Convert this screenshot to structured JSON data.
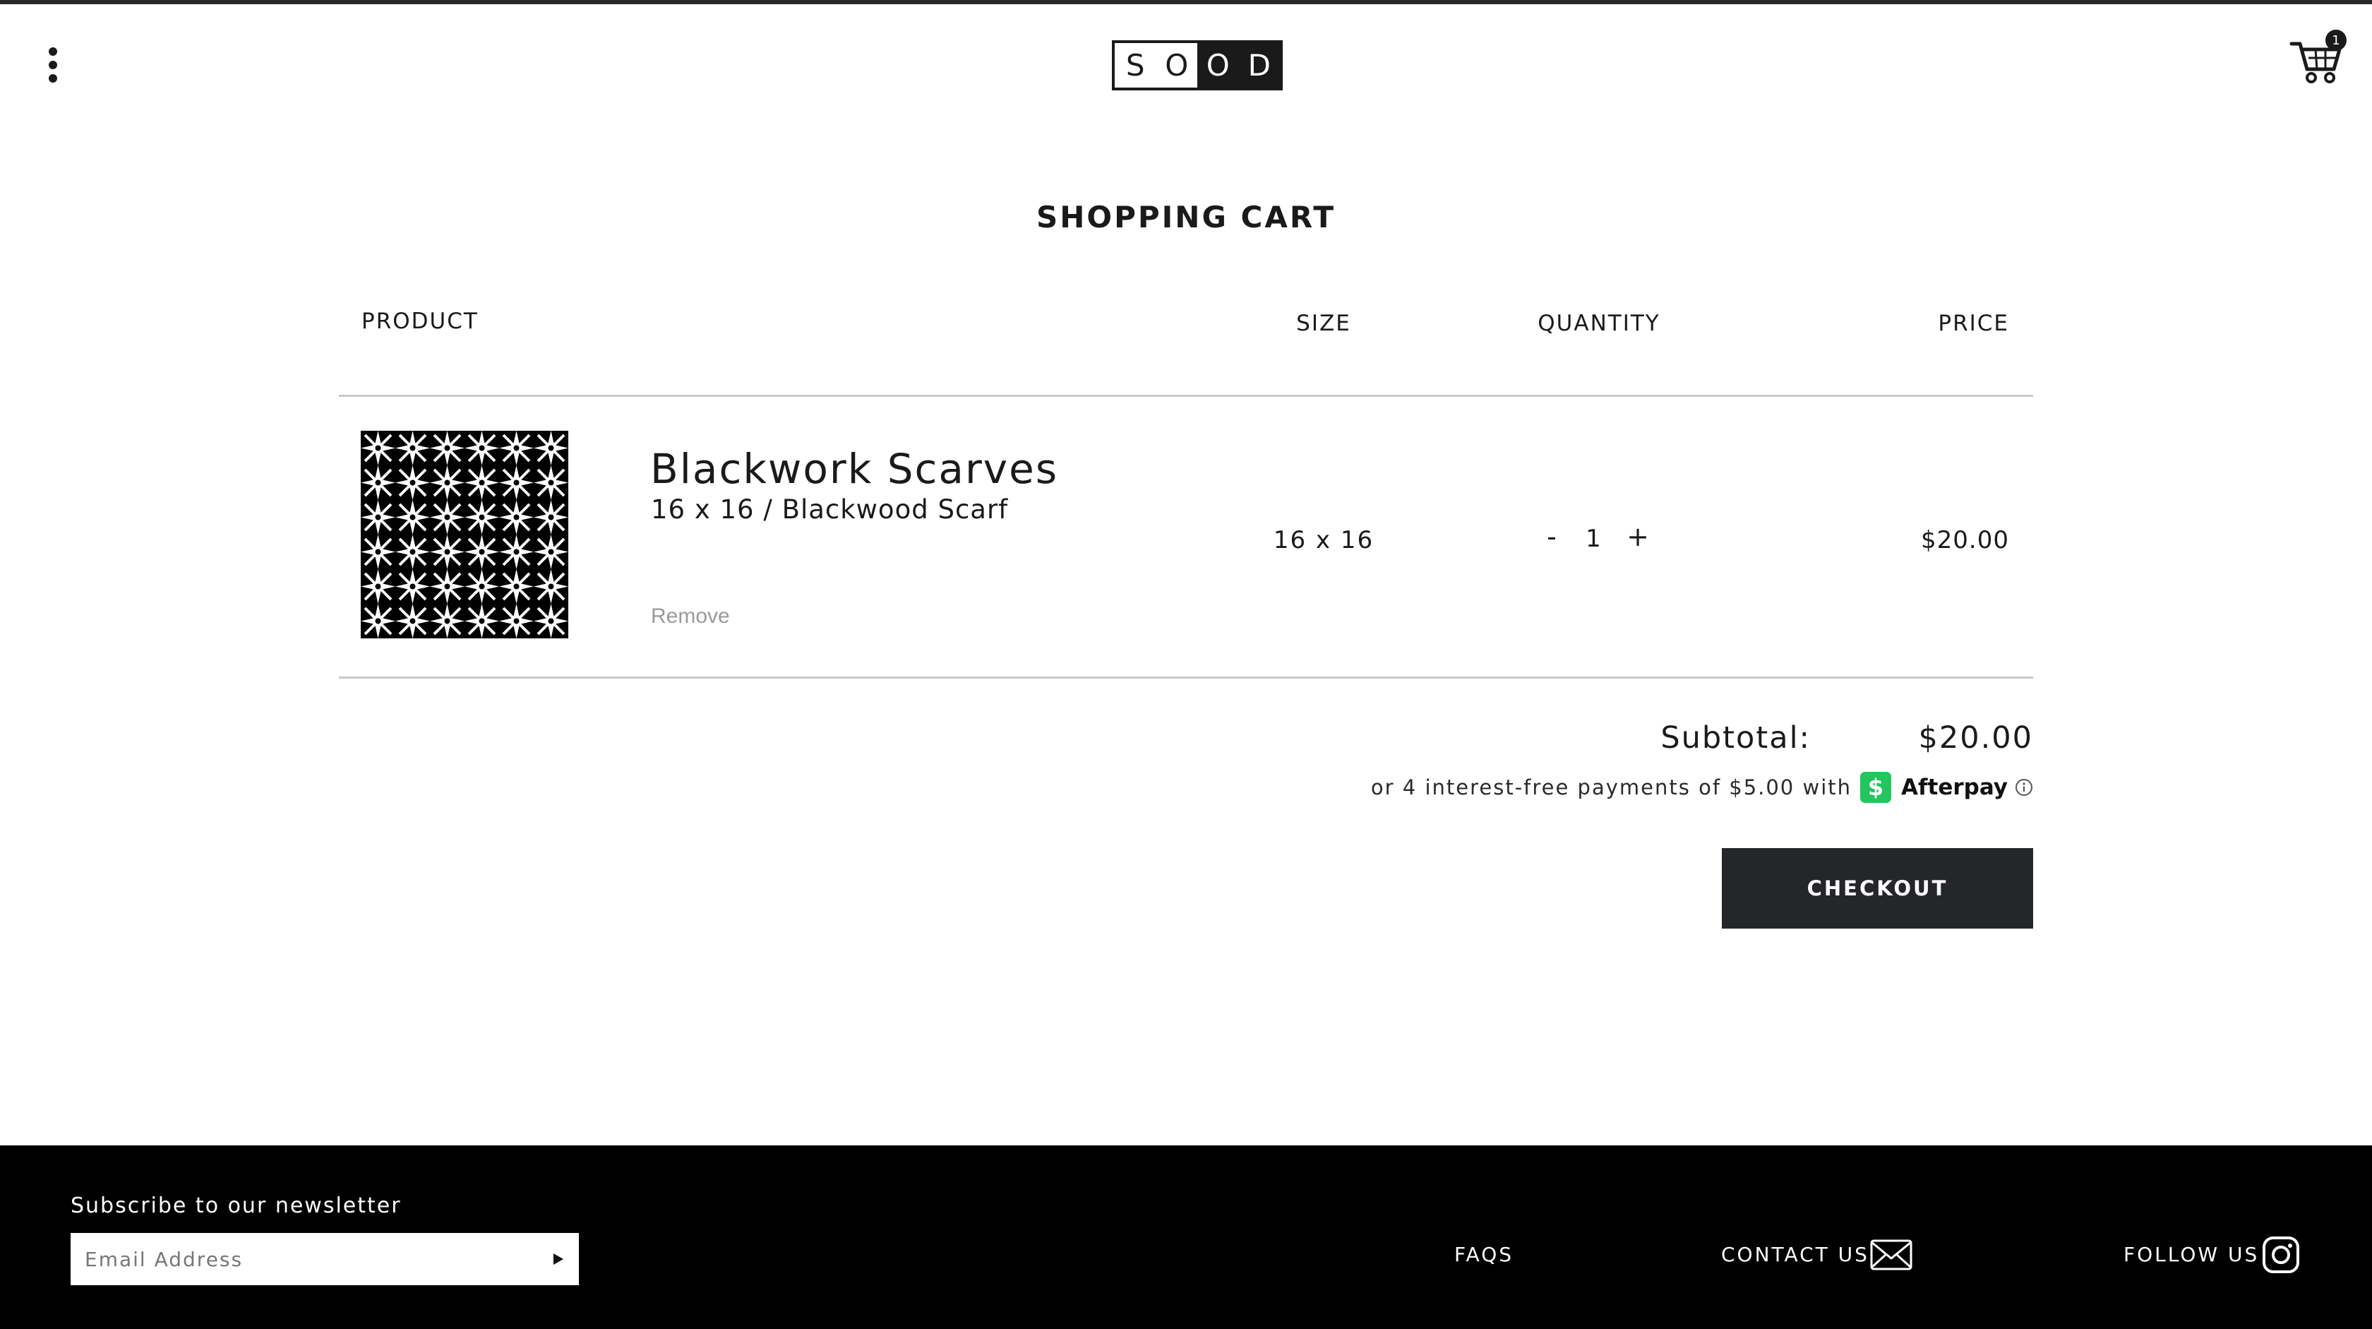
{
  "header": {
    "logo_letters": [
      "S",
      "O",
      "O",
      "D"
    ],
    "cart_count": "1",
    "icons": {
      "menu": "vertical-dots-icon",
      "cart": "cart-icon"
    }
  },
  "page": {
    "title": "SHOPPING CART"
  },
  "table": {
    "headers": {
      "product": "PRODUCT",
      "size": "SIZE",
      "quantity": "QUANTITY",
      "price": "PRICE"
    },
    "items": [
      {
        "name": "Blackwork Scarves",
        "variant": "16 x 16 / Blackwood Scarf",
        "remove_label": "Remove",
        "size": "16 x 16",
        "qty_minus": "-",
        "quantity": "1",
        "qty_plus": "+",
        "price": "$20.00",
        "thumbnail": "blackwork-pattern-image"
      }
    ]
  },
  "totals": {
    "subtotal_label": "Subtotal:",
    "subtotal_value": "$20.00",
    "afterpay_text": "or 4 interest-free payments of $5.00 with",
    "afterpay_badge": "$",
    "afterpay_brand": "Afterpay",
    "afterpay_color": "#22c55e"
  },
  "checkout": {
    "label": "CHECKOUT"
  },
  "footer": {
    "newsletter_label": "Subscribe to our newsletter",
    "email_placeholder": "Email Address",
    "faqs": "FAQS",
    "contact": "CONTACT US",
    "follow": "FOLLOW US",
    "icons": {
      "submit": "play-arrow-icon",
      "contact": "mail-icon",
      "follow": "instagram-icon"
    }
  },
  "colors": {
    "button": "#25262a",
    "footer": "#000000",
    "remove": "#9a9a9a"
  }
}
